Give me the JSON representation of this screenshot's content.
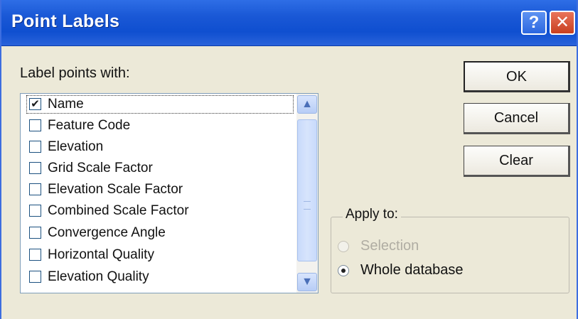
{
  "window": {
    "title": "Point Labels",
    "help_label": "?",
    "close_label": "✕"
  },
  "prompt": "Label points with:",
  "list": {
    "items": [
      {
        "label": "Name",
        "checked": true
      },
      {
        "label": "Feature Code",
        "checked": false
      },
      {
        "label": "Elevation",
        "checked": false
      },
      {
        "label": "Grid Scale Factor",
        "checked": false
      },
      {
        "label": "Elevation Scale Factor",
        "checked": false
      },
      {
        "label": "Combined Scale Factor",
        "checked": false
      },
      {
        "label": "Convergence Angle",
        "checked": false
      },
      {
        "label": "Horizontal Quality",
        "checked": false
      },
      {
        "label": "Elevation Quality",
        "checked": false
      }
    ],
    "check_glyph": "✔",
    "scroll_up_glyph": "▲",
    "scroll_down_glyph": "▼"
  },
  "buttons": {
    "ok": "OK",
    "cancel": "Cancel",
    "clear": "Clear"
  },
  "apply_to": {
    "legend": "Apply to:",
    "options": [
      {
        "label": "Selection",
        "selected": false,
        "enabled": false
      },
      {
        "label": "Whole database",
        "selected": true,
        "enabled": true
      }
    ]
  },
  "colors": {
    "titlebar": "#1a58d6",
    "dialog_bg": "#ece9d8",
    "close_button": "#c8401f"
  }
}
